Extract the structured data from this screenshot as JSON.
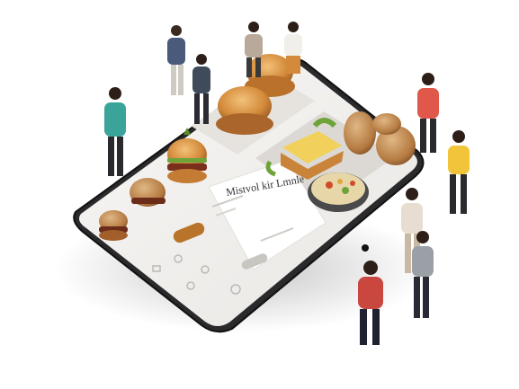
{
  "screen": {
    "heading": "Mistvol kir Lmnle",
    "button_label": "",
    "pill_label": ""
  },
  "icons": [
    "menu-icon",
    "cart-icon",
    "user-icon",
    "settings-icon",
    "home-icon"
  ],
  "colors": {
    "phone_frame": "#1d1d1f",
    "screen_bg": "#f3f2f1",
    "accent_button": "#b8742a",
    "tray": "#d7d2cc",
    "bun": "#d9943c",
    "salad": "#6ea33a"
  }
}
